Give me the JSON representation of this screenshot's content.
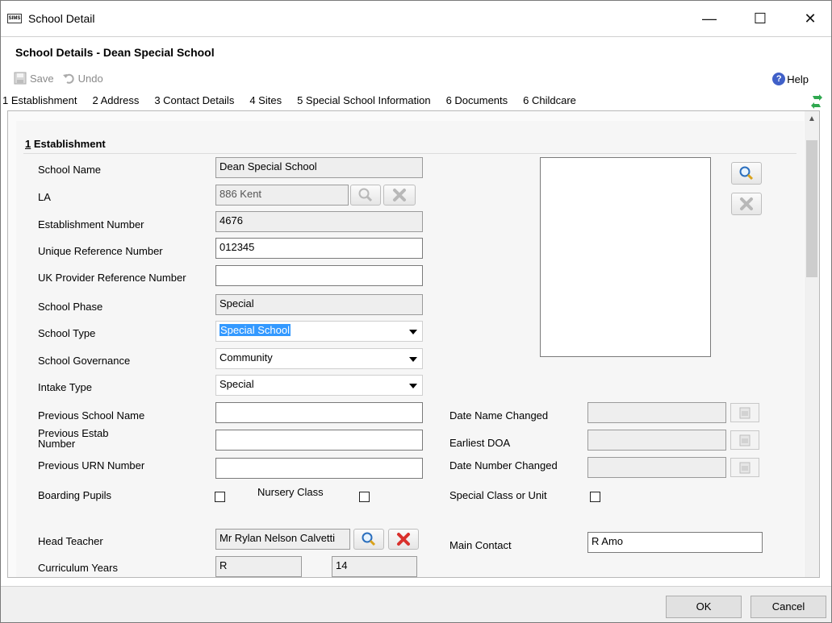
{
  "window": {
    "app_icon": "SIMS",
    "title": "School Detail",
    "minimize_glyph": "—",
    "maximize_glyph": "☐",
    "close_glyph": "✕"
  },
  "header": {
    "title": "School Details - Dean Special School"
  },
  "toolbar": {
    "save_label": "Save",
    "undo_label": "Undo",
    "help_label": "Help",
    "help_glyph": "?"
  },
  "tabs": [
    {
      "label": "1 Establishment"
    },
    {
      "label": "2 Address"
    },
    {
      "label": "3 Contact Details"
    },
    {
      "label": "4 Sites"
    },
    {
      "label": "5 Special School Information"
    },
    {
      "label": "6 Documents"
    },
    {
      "label": "6 Childcare"
    }
  ],
  "section": {
    "number": "1",
    "title": "Establishment"
  },
  "fields": {
    "school_name": {
      "label": "School Name",
      "value": "Dean Special School"
    },
    "la": {
      "label": "LA",
      "value": "886 Kent"
    },
    "establishment_number": {
      "label": "Establishment Number",
      "value": "4676"
    },
    "urn": {
      "label": "Unique Reference Number",
      "value": "012345"
    },
    "ukprn": {
      "label": "UK Provider Reference Number",
      "value": ""
    },
    "school_phase": {
      "label": "School Phase",
      "value": "Special"
    },
    "school_type": {
      "label": "School Type",
      "value": "Special School"
    },
    "school_governance": {
      "label": "School Governance",
      "value": "Community"
    },
    "intake_type": {
      "label": "Intake Type",
      "value": "Special"
    },
    "previous_school_name": {
      "label": "Previous School Name",
      "value": ""
    },
    "previous_estab_number": {
      "label_line1": "Previous Estab",
      "label_line2": "Number",
      "value": ""
    },
    "previous_urn": {
      "label": "Previous URN Number",
      "value": ""
    },
    "date_name_changed": {
      "label": "Date Name Changed",
      "value": ""
    },
    "earliest_doa": {
      "label": "Earliest DOA",
      "value": ""
    },
    "date_number_changed": {
      "label": "Date Number Changed",
      "value": ""
    },
    "boarding_pupils": {
      "label": "Boarding Pupils",
      "checked": false
    },
    "nursery_class": {
      "label": "Nursery Class",
      "checked": false
    },
    "special_class_or_unit": {
      "label": "Special Class or Unit",
      "checked": false
    },
    "head_teacher": {
      "label": "Head Teacher",
      "value": "Mr Rylan Nelson Calvetti"
    },
    "main_contact": {
      "label": "Main Contact",
      "value": "R Amo"
    },
    "curriculum_years": {
      "label": "Curriculum Years",
      "from": "R",
      "to": "14"
    }
  },
  "footer": {
    "ok_label": "OK",
    "cancel_label": "Cancel"
  },
  "colors": {
    "selection": "#3399ff",
    "help": "#4060c8",
    "refresh": "#2fa84f",
    "delete": "#d9302c"
  }
}
